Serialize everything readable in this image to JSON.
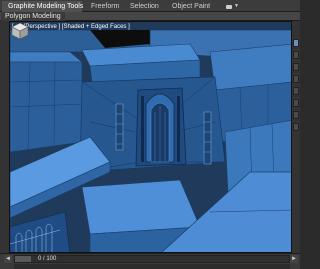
{
  "ribbon": {
    "tabs": [
      {
        "label": "Graphite Modeling Tools",
        "active": true
      },
      {
        "label": "Freeform",
        "active": false
      },
      {
        "label": "Selection",
        "active": false
      },
      {
        "label": "Object Paint",
        "active": false
      }
    ],
    "panel_label": "Polygon Modeling"
  },
  "viewport": {
    "label": "[ + ] [Perspective ] [Shaded + Edged Faces ]"
  },
  "timeline": {
    "frame_readout": "0 / 100",
    "prev_glyph": "◄",
    "next_glyph": "►"
  },
  "colors": {
    "accent": "#3b78c8",
    "background": "#2b2b2b",
    "viewport_bg": "#20354f"
  }
}
